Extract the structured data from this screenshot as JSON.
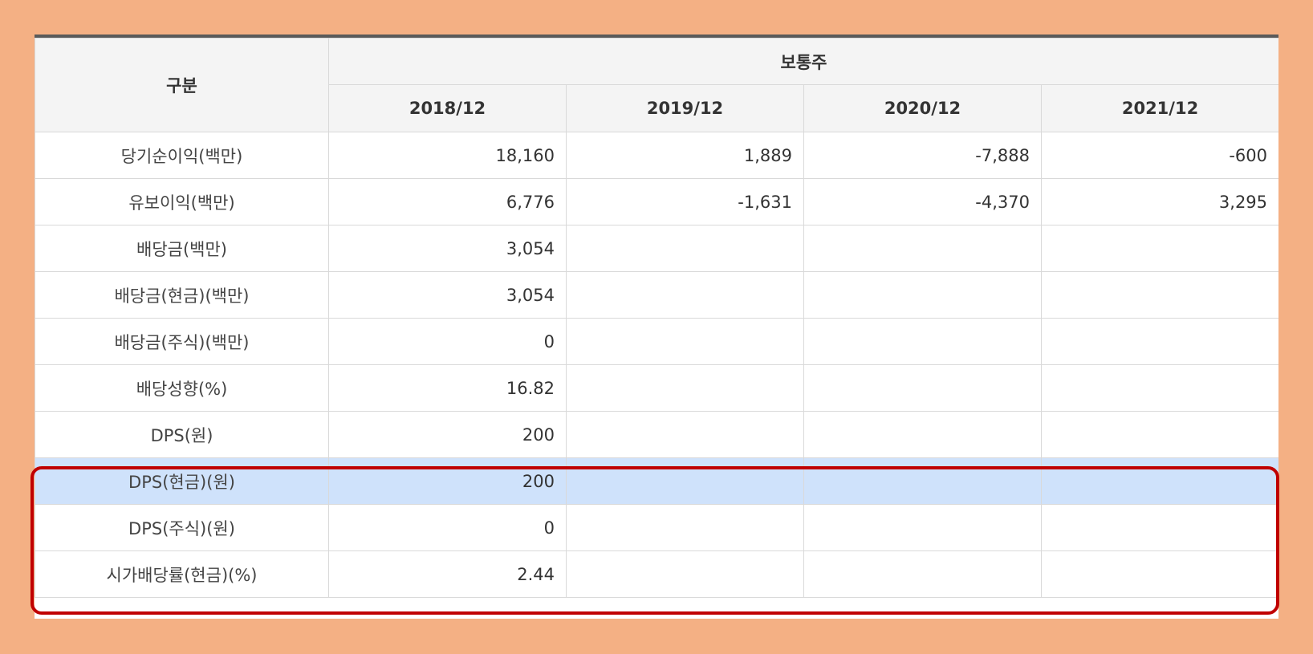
{
  "table": {
    "corner_header": "구분",
    "group_header": "보통주",
    "columns": [
      "2018/12",
      "2019/12",
      "2020/12",
      "2021/12"
    ],
    "rows": [
      {
        "label": "당기순이익(백만)",
        "values": [
          "18,160",
          "1,889",
          "-7,888",
          "-600"
        ]
      },
      {
        "label": "유보이익(백만)",
        "values": [
          "6,776",
          "-1,631",
          "-4,370",
          "3,295"
        ]
      },
      {
        "label": "배당금(백만)",
        "values": [
          "3,054",
          "",
          "",
          ""
        ]
      },
      {
        "label": "배당금(현금)(백만)",
        "values": [
          "3,054",
          "",
          "",
          ""
        ]
      },
      {
        "label": "배당금(주식)(백만)",
        "values": [
          "0",
          "",
          "",
          ""
        ]
      },
      {
        "label": "배당성향(%)",
        "values": [
          "16.82",
          "",
          "",
          ""
        ]
      },
      {
        "label": "DPS(원)",
        "values": [
          "200",
          "",
          "",
          ""
        ]
      },
      {
        "label": "DPS(현금)(원)",
        "values": [
          "200",
          "",
          "",
          ""
        ],
        "highlighted": true
      },
      {
        "label": "DPS(주식)(원)",
        "values": [
          "0",
          "",
          "",
          ""
        ]
      },
      {
        "label": "시가배당률(현금)(%)",
        "values": [
          "2.44",
          "",
          "",
          ""
        ]
      }
    ]
  },
  "colors": {
    "background": "#f4b084",
    "highlight_row": "#cfe2fb",
    "callout_border": "#c00000",
    "header_bg": "#f4f4f4"
  }
}
